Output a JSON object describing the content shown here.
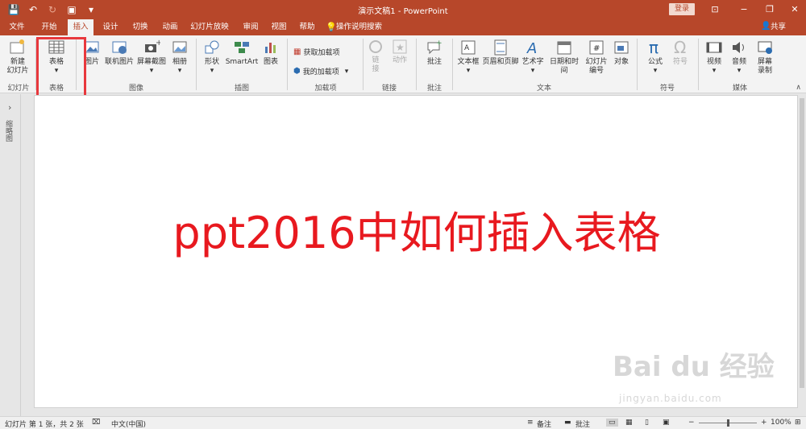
{
  "app": {
    "title": "演示文稿1  -  PowerPoint"
  },
  "titlebar": {
    "login": "登录"
  },
  "tabs": [
    {
      "label": "文件"
    },
    {
      "label": "开始"
    },
    {
      "label": "插入"
    },
    {
      "label": "设计"
    },
    {
      "label": "切换"
    },
    {
      "label": "动画"
    },
    {
      "label": "幻灯片放映"
    },
    {
      "label": "审阅"
    },
    {
      "label": "视图"
    },
    {
      "label": "帮助"
    }
  ],
  "tellme": "操作说明搜索",
  "share": "共享",
  "ribbon": {
    "new_slide": "新建\n幻灯片",
    "table": "表格",
    "picture": "图片",
    "online_picture": "联机图片",
    "screenshot": "屏幕截图",
    "album": "相册",
    "shapes": "形状",
    "smartart": "SmartArt",
    "chart": "图表",
    "get_addins": "获取加载项",
    "my_addins": "我的加载项",
    "link": "链\n接",
    "action": "动作",
    "comment": "批注",
    "textbox": "文本框",
    "header_footer": "页眉和页脚",
    "wordart": "艺术字",
    "datetime": "日期和时间",
    "slide_number": "幻灯片\n编号",
    "object": "对象",
    "equation": "公式",
    "symbol": "符号",
    "video": "视频",
    "audio": "音频",
    "screen_record": "屏幕\n录制",
    "groups": {
      "slides": "幻灯片",
      "table": "表格",
      "images": "图像",
      "illustrations": "插图",
      "addins": "加载项",
      "links": "链接",
      "comments": "批注",
      "text": "文本",
      "symbols": "符号",
      "media": "媒体"
    }
  },
  "thumbpane": {
    "label": "缩略图"
  },
  "slide": {
    "title": "ppt2016中如何插入表格"
  },
  "watermark": {
    "text": "Bai du 经验",
    "sub": "jingyan.baidu.com"
  },
  "statusbar": {
    "slide_info": "幻灯片 第 1 张，共 2 张",
    "language": "中文(中国)",
    "notes": "备注",
    "comments": "批注",
    "zoom": "100%"
  },
  "colors": {
    "accent": "#b7472a",
    "title_text": "#e8191f",
    "highlight": "#e8383d"
  }
}
